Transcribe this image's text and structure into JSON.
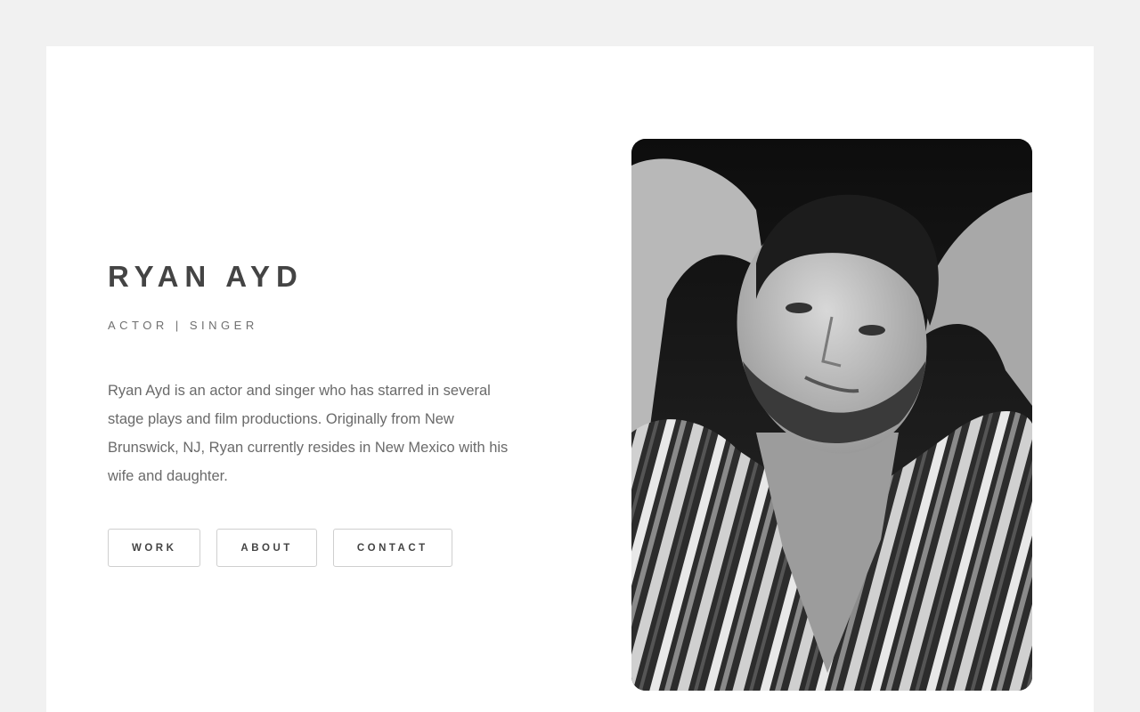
{
  "profile": {
    "name": "RYAN AYD",
    "roles": "ACTOR | SINGER",
    "bio": "Ryan Ayd is an actor and singer who has starred in several stage plays and film productions. Originally from New Brunswick, NJ, Ryan currently resides in New Mexico with his wife and daughter."
  },
  "nav": {
    "work": "WORK",
    "about": "ABOUT",
    "contact": "CONTACT"
  },
  "colors": {
    "page_background": "#f1f1f1",
    "card_background": "#ffffff",
    "text_dark": "#444444",
    "text_muted": "#6a6a6a",
    "button_border": "#cfcfcf"
  },
  "photo": {
    "icon": "portrait-photo",
    "style": "black-and-white"
  }
}
